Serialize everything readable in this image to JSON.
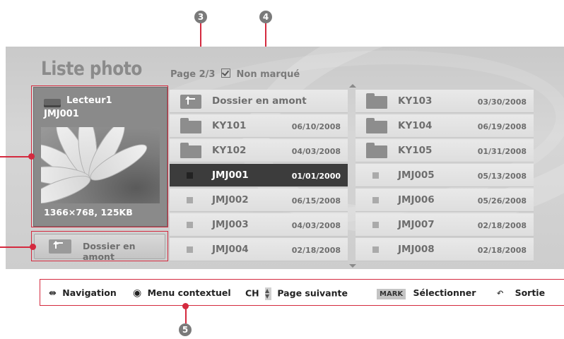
{
  "header": {
    "title": "Liste photo",
    "page_info": "Page 2/3",
    "mark_label": "Non marqué"
  },
  "preview": {
    "drive": "Lecteur1",
    "file": "JMJ001",
    "info": "1366×768, 125KB"
  },
  "up_button_label": "Dossier en amont",
  "items": [
    {
      "name": "Dossier en amont",
      "date": "",
      "type": "up"
    },
    {
      "name": "KY101",
      "date": "06/10/2008",
      "type": "folder"
    },
    {
      "name": "KY102",
      "date": "04/03/2008",
      "type": "folder"
    },
    {
      "name": "JMJ001",
      "date": "01/01/2000",
      "type": "photo",
      "selected": true
    },
    {
      "name": "JMJ002",
      "date": "06/15/2008",
      "type": "photo"
    },
    {
      "name": "JMJ003",
      "date": "04/03/2008",
      "type": "photo"
    },
    {
      "name": "JMJ004",
      "date": "02/18/2008",
      "type": "photo"
    },
    {
      "name": "KY103",
      "date": "03/30/2008",
      "type": "folder"
    },
    {
      "name": "KY104",
      "date": "06/19/2008",
      "type": "folder"
    },
    {
      "name": "KY105",
      "date": "01/31/2008",
      "type": "folder"
    },
    {
      "name": "JMJ005",
      "date": "05/13/2008",
      "type": "photo"
    },
    {
      "name": "JMJ006",
      "date": "05/26/2008",
      "type": "photo"
    },
    {
      "name": "JMJ007",
      "date": "02/18/2008",
      "type": "photo"
    },
    {
      "name": "JMJ008",
      "date": "02/18/2008",
      "type": "photo"
    }
  ],
  "footer": {
    "navigation": "Navigation",
    "menu": "Menu contextuel",
    "ch": "CH",
    "page_next": "Page suivante",
    "mark_key": "MARK",
    "select": "Sélectionner",
    "exit": "Sortie"
  },
  "callouts": {
    "c3": "3",
    "c4": "4",
    "c5": "5"
  },
  "colors": {
    "callout": "#d42a3f",
    "selected_row": "#3c3c3c"
  }
}
